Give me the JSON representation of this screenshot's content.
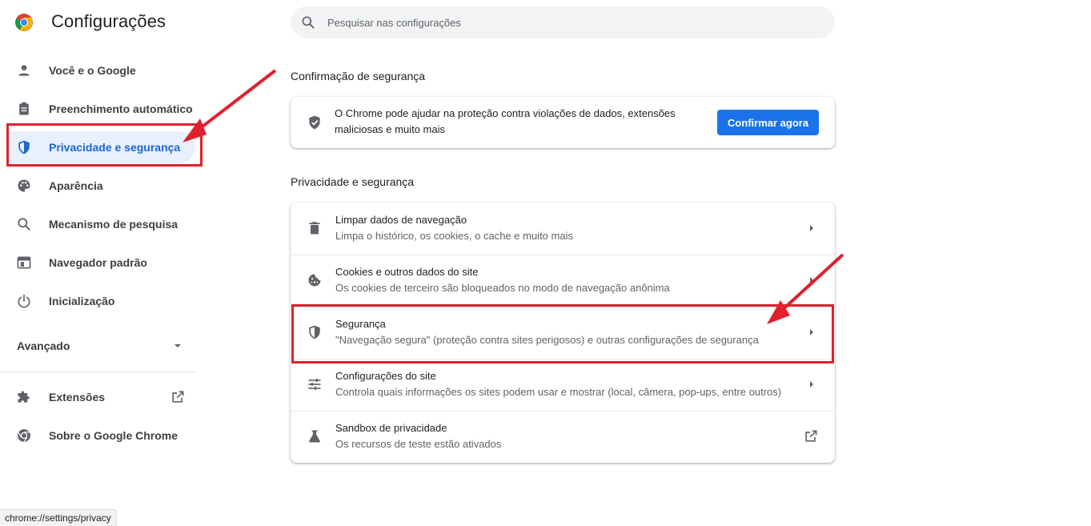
{
  "app": {
    "title": "Configurações"
  },
  "search": {
    "placeholder": "Pesquisar nas configurações"
  },
  "sidebar": {
    "items": [
      {
        "label": "Você e o Google",
        "icon": "person-icon"
      },
      {
        "label": "Preenchimento automático",
        "icon": "clipboard-icon"
      },
      {
        "label": "Privacidade e segurança",
        "icon": "shield-icon",
        "active": true
      },
      {
        "label": "Aparência",
        "icon": "palette-icon"
      },
      {
        "label": "Mecanismo de pesquisa",
        "icon": "search-icon"
      },
      {
        "label": "Navegador padrão",
        "icon": "browser-window-icon"
      },
      {
        "label": "Inicialização",
        "icon": "power-icon"
      }
    ],
    "advanced": "Avançado",
    "extensions": "Extensões",
    "about": "Sobre o Google Chrome"
  },
  "safety_check": {
    "title": "Confirmação de segurança",
    "description": "O Chrome pode ajudar na proteção contra violações de dados, extensões maliciosas e muito mais",
    "button": "Confirmar agora"
  },
  "privacy": {
    "title": "Privacidade e segurança",
    "rows": [
      {
        "title": "Limpar dados de navegação",
        "subtitle": "Limpa o histórico, os cookies, o cache e muito mais",
        "icon": "trash-icon"
      },
      {
        "title": "Cookies e outros dados do site",
        "subtitle": "Os cookies de terceiro são bloqueados no modo de navegação anônima",
        "icon": "cookie-icon"
      },
      {
        "title": "Segurança",
        "subtitle": "\"Navegação segura\" (proteção contra sites perigosos) e outras configurações de segurança",
        "icon": "shield-icon"
      },
      {
        "title": "Configurações do site",
        "subtitle": "Controla quais informações os sites podem usar e mostrar (local, câmera, pop-ups, entre outros)",
        "icon": "sliders-icon"
      },
      {
        "title": "Sandbox de privacidade",
        "subtitle": "Os recursos de teste estão ativados",
        "icon": "flask-icon"
      }
    ]
  },
  "status_bar": {
    "url": "chrome://settings/privacy"
  },
  "colors": {
    "accent": "#1a73e8",
    "active_bg": "#e8f0fe",
    "annotation": "#e0202c"
  }
}
